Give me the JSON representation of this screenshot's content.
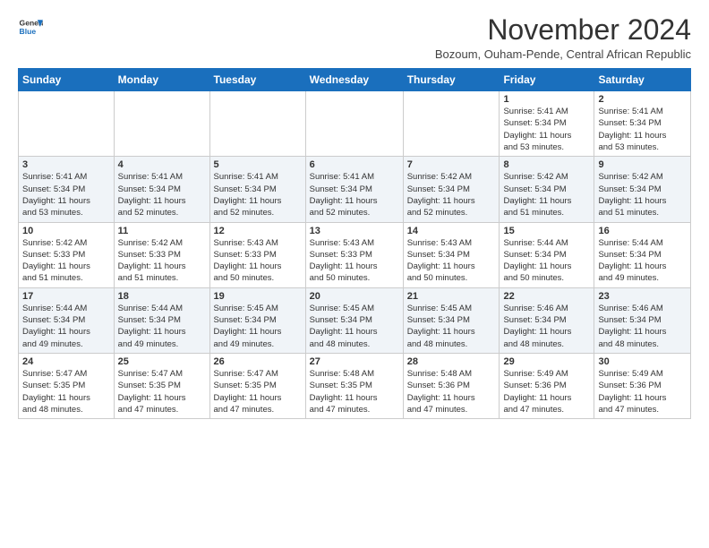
{
  "logo": {
    "line1": "General",
    "line2": "Blue"
  },
  "header": {
    "month": "November 2024",
    "location": "Bozoum, Ouham-Pende, Central African Republic"
  },
  "days_of_week": [
    "Sunday",
    "Monday",
    "Tuesday",
    "Wednesday",
    "Thursday",
    "Friday",
    "Saturday"
  ],
  "weeks": [
    [
      {
        "day": "",
        "info": ""
      },
      {
        "day": "",
        "info": ""
      },
      {
        "day": "",
        "info": ""
      },
      {
        "day": "",
        "info": ""
      },
      {
        "day": "",
        "info": ""
      },
      {
        "day": "1",
        "info": "Sunrise: 5:41 AM\nSunset: 5:34 PM\nDaylight: 11 hours\nand 53 minutes."
      },
      {
        "day": "2",
        "info": "Sunrise: 5:41 AM\nSunset: 5:34 PM\nDaylight: 11 hours\nand 53 minutes."
      }
    ],
    [
      {
        "day": "3",
        "info": "Sunrise: 5:41 AM\nSunset: 5:34 PM\nDaylight: 11 hours\nand 53 minutes."
      },
      {
        "day": "4",
        "info": "Sunrise: 5:41 AM\nSunset: 5:34 PM\nDaylight: 11 hours\nand 52 minutes."
      },
      {
        "day": "5",
        "info": "Sunrise: 5:41 AM\nSunset: 5:34 PM\nDaylight: 11 hours\nand 52 minutes."
      },
      {
        "day": "6",
        "info": "Sunrise: 5:41 AM\nSunset: 5:34 PM\nDaylight: 11 hours\nand 52 minutes."
      },
      {
        "day": "7",
        "info": "Sunrise: 5:42 AM\nSunset: 5:34 PM\nDaylight: 11 hours\nand 52 minutes."
      },
      {
        "day": "8",
        "info": "Sunrise: 5:42 AM\nSunset: 5:34 PM\nDaylight: 11 hours\nand 51 minutes."
      },
      {
        "day": "9",
        "info": "Sunrise: 5:42 AM\nSunset: 5:34 PM\nDaylight: 11 hours\nand 51 minutes."
      }
    ],
    [
      {
        "day": "10",
        "info": "Sunrise: 5:42 AM\nSunset: 5:33 PM\nDaylight: 11 hours\nand 51 minutes."
      },
      {
        "day": "11",
        "info": "Sunrise: 5:42 AM\nSunset: 5:33 PM\nDaylight: 11 hours\nand 51 minutes."
      },
      {
        "day": "12",
        "info": "Sunrise: 5:43 AM\nSunset: 5:33 PM\nDaylight: 11 hours\nand 50 minutes."
      },
      {
        "day": "13",
        "info": "Sunrise: 5:43 AM\nSunset: 5:33 PM\nDaylight: 11 hours\nand 50 minutes."
      },
      {
        "day": "14",
        "info": "Sunrise: 5:43 AM\nSunset: 5:34 PM\nDaylight: 11 hours\nand 50 minutes."
      },
      {
        "day": "15",
        "info": "Sunrise: 5:44 AM\nSunset: 5:34 PM\nDaylight: 11 hours\nand 50 minutes."
      },
      {
        "day": "16",
        "info": "Sunrise: 5:44 AM\nSunset: 5:34 PM\nDaylight: 11 hours\nand 49 minutes."
      }
    ],
    [
      {
        "day": "17",
        "info": "Sunrise: 5:44 AM\nSunset: 5:34 PM\nDaylight: 11 hours\nand 49 minutes."
      },
      {
        "day": "18",
        "info": "Sunrise: 5:44 AM\nSunset: 5:34 PM\nDaylight: 11 hours\nand 49 minutes."
      },
      {
        "day": "19",
        "info": "Sunrise: 5:45 AM\nSunset: 5:34 PM\nDaylight: 11 hours\nand 49 minutes."
      },
      {
        "day": "20",
        "info": "Sunrise: 5:45 AM\nSunset: 5:34 PM\nDaylight: 11 hours\nand 48 minutes."
      },
      {
        "day": "21",
        "info": "Sunrise: 5:45 AM\nSunset: 5:34 PM\nDaylight: 11 hours\nand 48 minutes."
      },
      {
        "day": "22",
        "info": "Sunrise: 5:46 AM\nSunset: 5:34 PM\nDaylight: 11 hours\nand 48 minutes."
      },
      {
        "day": "23",
        "info": "Sunrise: 5:46 AM\nSunset: 5:34 PM\nDaylight: 11 hours\nand 48 minutes."
      }
    ],
    [
      {
        "day": "24",
        "info": "Sunrise: 5:47 AM\nSunset: 5:35 PM\nDaylight: 11 hours\nand 48 minutes."
      },
      {
        "day": "25",
        "info": "Sunrise: 5:47 AM\nSunset: 5:35 PM\nDaylight: 11 hours\nand 47 minutes."
      },
      {
        "day": "26",
        "info": "Sunrise: 5:47 AM\nSunset: 5:35 PM\nDaylight: 11 hours\nand 47 minutes."
      },
      {
        "day": "27",
        "info": "Sunrise: 5:48 AM\nSunset: 5:35 PM\nDaylight: 11 hours\nand 47 minutes."
      },
      {
        "day": "28",
        "info": "Sunrise: 5:48 AM\nSunset: 5:36 PM\nDaylight: 11 hours\nand 47 minutes."
      },
      {
        "day": "29",
        "info": "Sunrise: 5:49 AM\nSunset: 5:36 PM\nDaylight: 11 hours\nand 47 minutes."
      },
      {
        "day": "30",
        "info": "Sunrise: 5:49 AM\nSunset: 5:36 PM\nDaylight: 11 hours\nand 47 minutes."
      }
    ]
  ]
}
